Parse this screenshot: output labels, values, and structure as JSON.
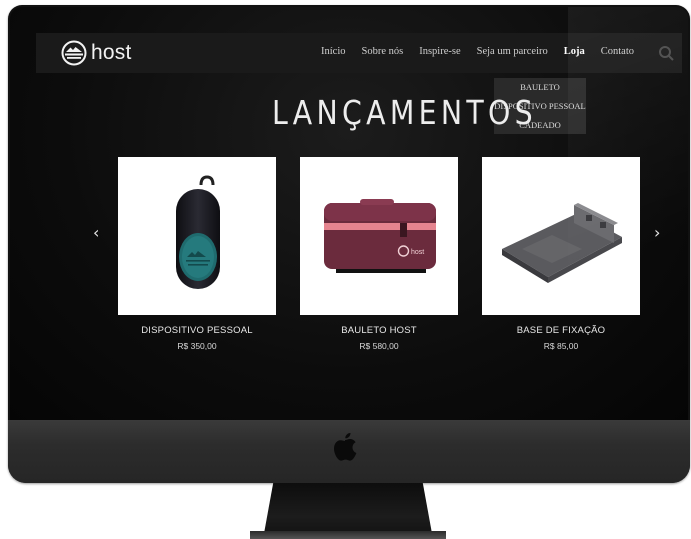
{
  "brand": {
    "name": "host",
    "logo_icon": "host-logo-icon"
  },
  "nav": {
    "items": [
      "Início",
      "Sobre nós",
      "Inspire-se",
      "Seja um parceiro",
      "Loja",
      "Contato"
    ],
    "active": "Loja",
    "search_icon": "search-icon"
  },
  "dropdown": {
    "items": [
      "BAULETO",
      "DISPOSITIVO PESSOAL",
      "CADEADO"
    ]
  },
  "page": {
    "title": "LANÇAMENTOS"
  },
  "carousel": {
    "prev": "‹",
    "next": "›",
    "products": [
      {
        "name": "DISPOSITIVO PESSOAL",
        "price": "R$ 350,00",
        "image": "personal-device-image"
      },
      {
        "name": "BAULETO HOST",
        "price": "R$ 580,00",
        "image": "top-case-image",
        "badge_text": "host"
      },
      {
        "name": "BASE DE FIXAÇÃO",
        "price": "R$ 85,00",
        "image": "mounting-base-image"
      }
    ]
  },
  "colors": {
    "accent_pink": "#e5848f",
    "case_burgundy": "#6b2b3d",
    "device_teal": "#1f6b6e"
  },
  "device": {
    "logo_icon": "apple-logo-icon"
  }
}
